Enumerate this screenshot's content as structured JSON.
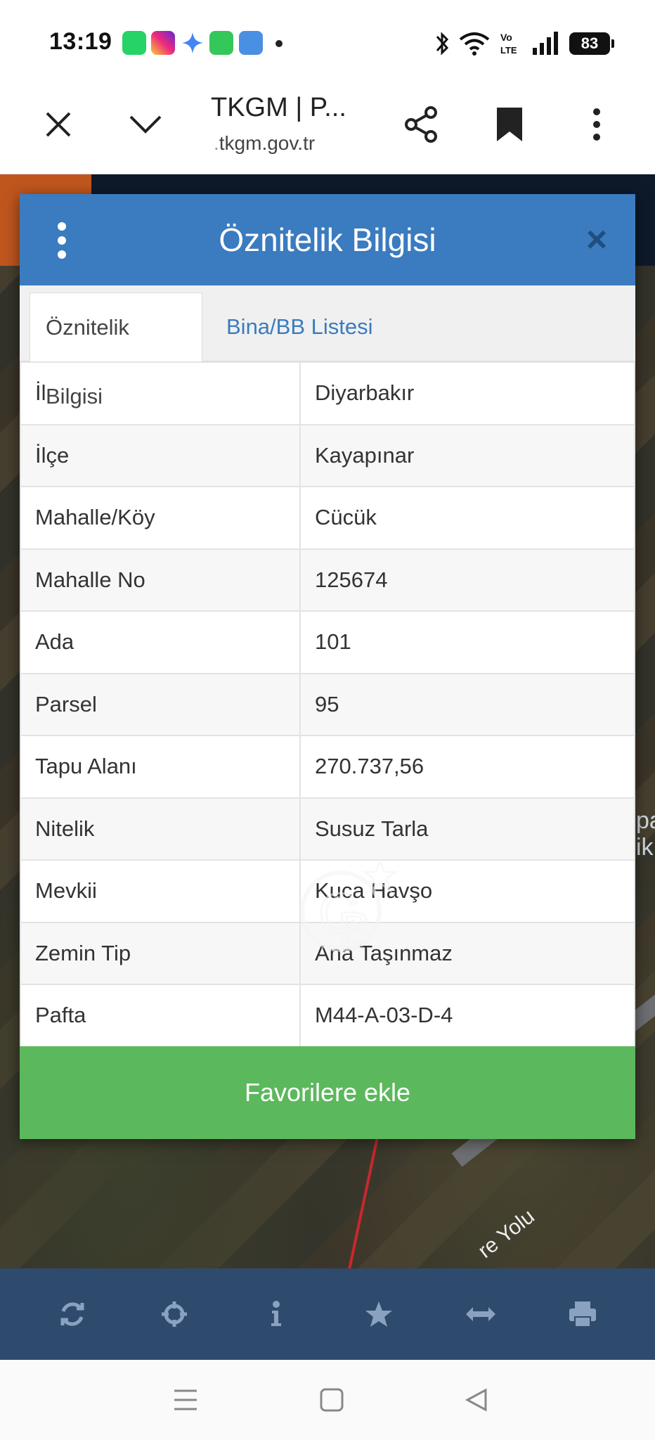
{
  "status_bar": {
    "time": "13:19",
    "notifications": [
      "whatsapp-icon",
      "instagram-icon",
      "gemini-icon",
      "messages-icon",
      "weather-icon"
    ],
    "battery": "83",
    "network_label": "Vo LTE"
  },
  "browser": {
    "title": "TKGM | P...",
    "url_prefix": ".",
    "url": "tkgm.gov.tr"
  },
  "map": {
    "road_label": "re Yolu",
    "right_edge_text": "pa ik",
    "colors": {
      "header_dark": "#0e1a2a",
      "accent_orange": "#c0561e",
      "parcel_line": "#c8282c"
    }
  },
  "modal": {
    "title": "Öznitelik Bilgisi",
    "close_symbol": "×",
    "header_color": "#3b7bbf",
    "tabs": [
      {
        "label": "Öznitelik Bilgisi",
        "active": true
      },
      {
        "label": "Bina/BB Listesi",
        "active": false
      }
    ],
    "rows": [
      {
        "key": "İl",
        "value": "Diyarbakır"
      },
      {
        "key": "İlçe",
        "value": "Kayapınar"
      },
      {
        "key": "Mahalle/Köy",
        "value": "Cücük"
      },
      {
        "key": "Mahalle No",
        "value": "125674"
      },
      {
        "key": "Ada",
        "value": "101"
      },
      {
        "key": "Parsel",
        "value": "95"
      },
      {
        "key": "Tapu Alanı",
        "value": "270.737,56"
      },
      {
        "key": "Nitelik",
        "value": "Susuz Tarla"
      },
      {
        "key": "Mevkii",
        "value": "Kuca Havşo"
      },
      {
        "key": "Zemin Tip",
        "value": "Ana Taşınmaz"
      },
      {
        "key": "Pafta",
        "value": "M44-A-03-D-4"
      }
    ],
    "favorite_button": "Favorilere ekle",
    "favorite_color": "#5cb85c"
  },
  "map_tools": [
    "refresh-icon",
    "crosshair-icon",
    "info-icon",
    "star-icon",
    "measure-icon",
    "print-icon"
  ],
  "nav_bar": [
    "menu-icon",
    "home-icon",
    "back-icon"
  ]
}
